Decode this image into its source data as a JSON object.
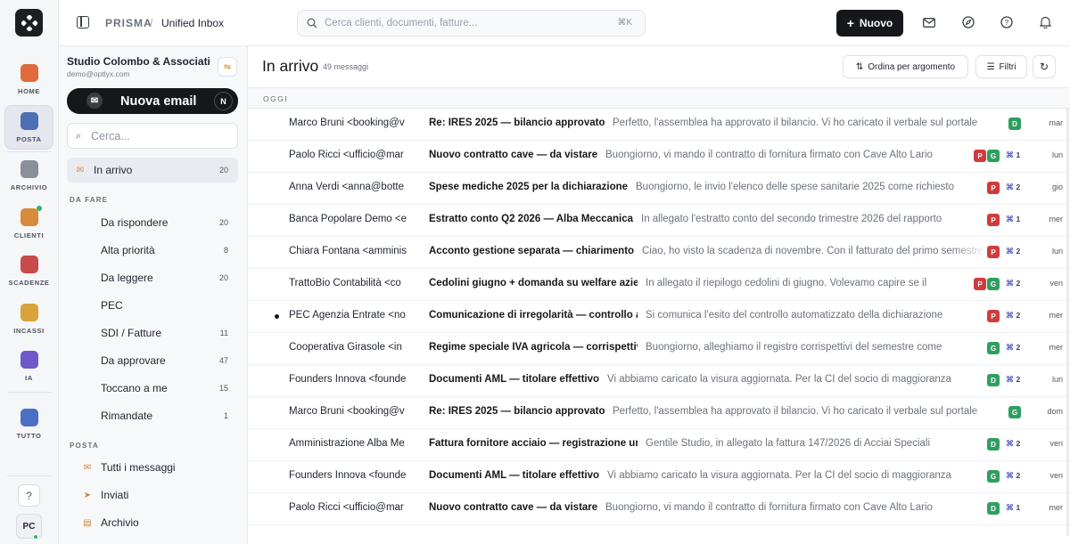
{
  "rail": {
    "items": [
      {
        "label": "HOME",
        "icon": "home-icon",
        "color": "#e06a3b"
      },
      {
        "label": "POSTA",
        "icon": "mail-icon",
        "color": "#4a6fb5"
      },
      {
        "label": "ARCHIVIO",
        "icon": "archive-icon",
        "color": "#8a8f99"
      },
      {
        "label": "CLIENTI",
        "icon": "clients-icon",
        "color": "#d88b3a"
      },
      {
        "label": "SCADENZE",
        "icon": "calendar-icon",
        "color": "#c94a4a"
      },
      {
        "label": "INCASSI",
        "icon": "money-icon",
        "color": "#d9a23a"
      },
      {
        "label": "IA",
        "icon": "ai-icon",
        "color": "#6d59c9"
      },
      {
        "label": "TUTTO",
        "icon": "all-icon",
        "color": "#4b6fc4"
      }
    ],
    "help_glyph": "?",
    "user_initials": "PC"
  },
  "topbar": {
    "brand": "PRISMA",
    "separator": "/",
    "page": "Unified Inbox",
    "search_placeholder": "Cerca clienti, documenti, fatture...",
    "search_shortcut": "⌘K",
    "new_label": "Nuovo"
  },
  "panel": {
    "org_name": "Studio Colombo & Associati",
    "org_email": "demo@optlyx.com",
    "compose_label": "Nuova email",
    "compose_shortcut": "N",
    "search_placeholder": "Cerca...",
    "inbox": {
      "label": "In arrivo",
      "count": "20"
    },
    "section_todo": "DA FARE",
    "todo": [
      {
        "label": "Da rispondere",
        "count": "20"
      },
      {
        "label": "Alta priorità",
        "count": "8"
      },
      {
        "label": "Da leggere",
        "count": "20"
      },
      {
        "label": "PEC",
        "count": ""
      },
      {
        "label": "SDI / Fatture",
        "count": "11"
      },
      {
        "label": "Da approvare",
        "count": "47"
      },
      {
        "label": "Toccano a me",
        "count": "15"
      },
      {
        "label": "Rimandate",
        "count": "1"
      }
    ],
    "section_mail": "POSTA",
    "mail": [
      {
        "label": "Tutti i messaggi",
        "icon": "all-mail-icon"
      },
      {
        "label": "Inviati",
        "icon": "sent-icon"
      },
      {
        "label": "Archivio",
        "icon": "archive-box-icon"
      }
    ]
  },
  "main": {
    "title": "In arrivo",
    "count": "49 messaggi",
    "sort_label": "Ordina per argomento",
    "filter_label": "Filtri",
    "group_label": "OGGI",
    "rows": [
      {
        "sender": "Marco Bruni <booking@v",
        "subject": "Re: IRES 2025 — bilancio approvato",
        "preview": "Perfetto, l'assemblea ha approvato il bilancio. Vi ho caricato il verbale sul portale",
        "tags": [
          "D"
        ],
        "att": "",
        "date": "mar",
        "unread": false
      },
      {
        "sender": "Paolo Ricci <ufficio@mar",
        "subject": "Nuovo contratto cave — da vistare",
        "preview": "Buongiorno, vi mando il contratto di fornitura firmato con Cave Alto Lario",
        "tags": [
          "P",
          "G"
        ],
        "att": "1",
        "date": "lun",
        "unread": false
      },
      {
        "sender": "Anna Verdi <anna@botte",
        "subject": "Spese mediche 2025 per la dichiarazione",
        "preview": "Buongiorno, le invio l'elenco delle spese sanitarie 2025 come richiesto",
        "tags": [
          "P"
        ],
        "att": "2",
        "date": "gio",
        "unread": false
      },
      {
        "sender": "Banca Popolare Demo <e",
        "subject": "Estratto conto Q2 2026 — Alba Meccanica",
        "preview": "In allegato l'estratto conto del secondo trimestre 2026 del rapporto",
        "tags": [
          "P"
        ],
        "att": "1",
        "date": "mer",
        "unread": false
      },
      {
        "sender": "Chiara Fontana <amminis",
        "subject": "Acconto gestione separata — chiarimento",
        "preview": "Ciao, ho visto la scadenza di novembre. Con il fatturato del primo semestre",
        "tags": [
          "P"
        ],
        "att": "2",
        "date": "lun",
        "unread": false
      },
      {
        "sender": "TrattoBio Contabilità <co",
        "subject": "Cedolini giugno + domanda su welfare aziendale",
        "preview": "In allegato il riepilogo cedolini di giugno. Volevamo capire se il",
        "tags": [
          "P",
          "G"
        ],
        "att": "2",
        "date": "ven",
        "unread": false
      },
      {
        "sender": "PEC Agenzia Entrate <no",
        "subject": "Comunicazione di irregolarità — controllo automatizzato",
        "preview": "Si comunica l'esito del controllo automatizzato della dichiarazione",
        "tags": [
          "P"
        ],
        "att": "2",
        "date": "mer",
        "unread": true
      },
      {
        "sender": "Cooperativa Girasole <in",
        "subject": "Regime speciale IVA agricola — corrispettivi",
        "preview": "Buongiorno, alleghiamo il registro corrispettivi del semestre come",
        "tags": [
          "G"
        ],
        "att": "2",
        "date": "mer",
        "unread": false
      },
      {
        "sender": "Founders Innova <founde",
        "subject": "Documenti AML — titolare effettivo",
        "preview": "Vi abbiamo caricato la visura aggiornata. Per la CI del socio di maggioranza",
        "tags": [
          "D"
        ],
        "att": "2",
        "date": "lun",
        "unread": false
      },
      {
        "sender": "Marco Bruni <booking@v",
        "subject": "Re: IRES 2025 — bilancio approvato",
        "preview": "Perfetto, l'assemblea ha approvato il bilancio. Vi ho caricato il verbale sul portale",
        "tags": [
          "G"
        ],
        "att": "",
        "date": "dom",
        "unread": false
      },
      {
        "sender": "Amministrazione Alba Me",
        "subject": "Fattura fornitore acciaio — registrazione urgente",
        "preview": "Gentile Studio, in allegato la fattura 147/2026 di Acciai Speciali",
        "tags": [
          "D"
        ],
        "att": "2",
        "date": "ven",
        "unread": false
      },
      {
        "sender": "Founders Innova <founde",
        "subject": "Documenti AML — titolare effettivo",
        "preview": "Vi abbiamo caricato la visura aggiornata. Per la CI del socio di maggioranza",
        "tags": [
          "G"
        ],
        "att": "2",
        "date": "ven",
        "unread": false
      },
      {
        "sender": "Paolo Ricci <ufficio@mar",
        "subject": "Nuovo contratto cave — da vistare",
        "preview": "Buongiorno, vi mando il contratto di fornitura firmato con Cave Alto Lario",
        "tags": [
          "D"
        ],
        "att": "1",
        "date": "mer",
        "unread": false
      }
    ]
  },
  "colors": {
    "accent": "#15171b",
    "tag_green": "#2f9e5e",
    "tag_red": "#d23b3b",
    "attach": "#5a62c8"
  }
}
